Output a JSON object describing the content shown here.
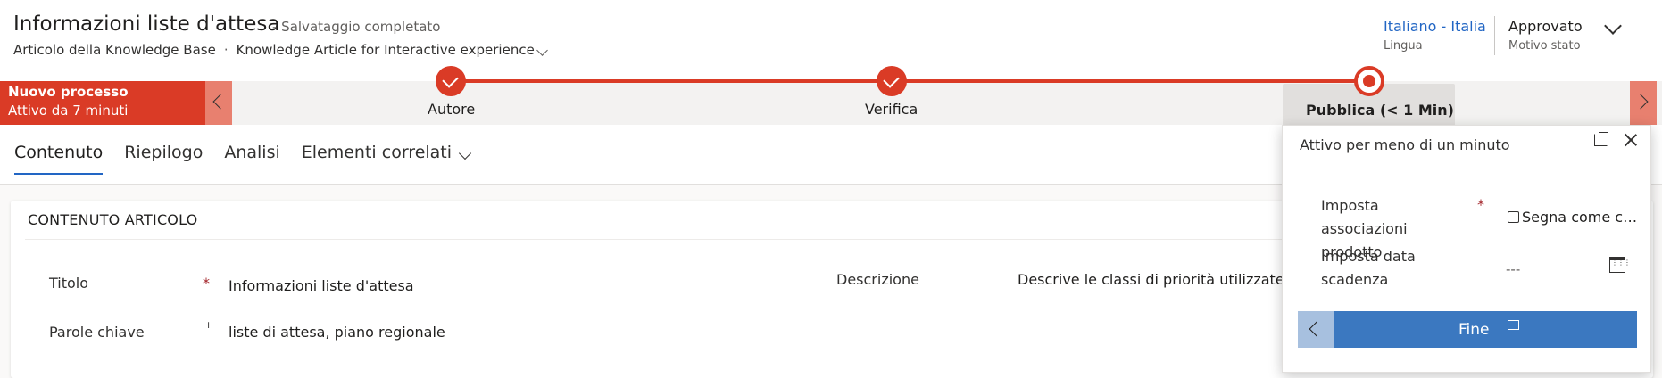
{
  "header": {
    "title": "Informazioni liste d'attesa",
    "save_status": "- Salvataggio completato",
    "entity": "Articolo della Knowledge Base",
    "separator": "·",
    "form": "Knowledge Article for Interactive experience",
    "language_value": "Italiano - Italia",
    "language_label": "Lingua",
    "status_value": "Approvato",
    "status_label": "Motivo stato"
  },
  "process": {
    "name": "Nuovo processo",
    "duration": "Attivo da 7 minuti",
    "stages": [
      {
        "label": "Autore",
        "state": "completed"
      },
      {
        "label": "Verifica",
        "state": "completed"
      },
      {
        "label": "Pubblica  (< 1 Min)",
        "state": "active"
      }
    ]
  },
  "tabs": [
    {
      "label": "Contenuto",
      "selected": true
    },
    {
      "label": "Riepilogo",
      "selected": false
    },
    {
      "label": "Analisi",
      "selected": false
    },
    {
      "label": "Elementi correlati",
      "selected": false
    }
  ],
  "section": {
    "title": "CONTENUTO ARTICOLO",
    "fields": {
      "titolo_label": "Titolo",
      "titolo_required": "*",
      "titolo_value": "Informazioni liste d'attesa",
      "parole_label": "Parole chiave",
      "parole_required": "+",
      "parole_value": "liste di attesa, piano regionale",
      "descrizione_label": "Descrizione",
      "descrizione_value": "Descrive le classi di priorità utilizzate per"
    }
  },
  "flyout": {
    "header": "Attivo per meno di un minuto",
    "field1_label": "Imposta associazioni prodotto",
    "field1_required": "*",
    "field1_checkbox_label": "Segna come completato",
    "field2_label": "Imposta data scadenza",
    "field2_value": "---",
    "finish_label": "Fine"
  },
  "colors": {
    "accent_red": "#da3b26",
    "link_blue": "#2266c4",
    "button_blue": "#3b78c0"
  }
}
